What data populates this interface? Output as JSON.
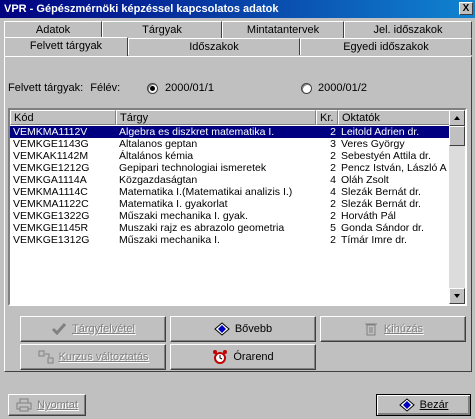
{
  "window": {
    "title": "VPR - Gépészmérnöki képzéssel kapcsolatos adatok",
    "close_glyph": "X"
  },
  "tabs": {
    "row1": [
      "Adatok",
      "Tárgyak",
      "Mintatantervek",
      "Jel. időszakok"
    ],
    "row2": [
      "Felvett tárgyak",
      "Időszakok",
      "Egyedi időszakok"
    ],
    "active": "Felvett tárgyak"
  },
  "semester": {
    "label": "Felvett tárgyak:",
    "period_label": "Félév:",
    "options": [
      {
        "label": "2000/01/1",
        "checked": true
      },
      {
        "label": "2000/01/2",
        "checked": false
      }
    ]
  },
  "table": {
    "columns": [
      "Kód",
      "Tárgy",
      "Kr.",
      "Oktatók"
    ],
    "selected_index": 0,
    "rows": [
      {
        "code": "VEMKMA1112V",
        "subject": "Algebra es diszkret matematika I.",
        "credits": "2",
        "teacher": "Leitold Adrien dr."
      },
      {
        "code": "VEMKGE1143G",
        "subject": "Altalanos geptan",
        "credits": "3",
        "teacher": "Veres György"
      },
      {
        "code": "VEMKAK1142M",
        "subject": "Általános kémia",
        "credits": "2",
        "teacher": "Sebestyén Attila dr."
      },
      {
        "code": "VEMKGE1212G",
        "subject": "Gepipari technologiai ismeretek",
        "credits": "2",
        "teacher": "Pencz István, László A"
      },
      {
        "code": "VEMKGA1114A",
        "subject": "Közgazdaságtan",
        "credits": "4",
        "teacher": "Oláh Zsolt"
      },
      {
        "code": "VEMKMA1114C",
        "subject": "Matematika I.(Matematikai analizis I.)",
        "credits": "4",
        "teacher": "Slezák Bernát dr."
      },
      {
        "code": "VEMKMA1122C",
        "subject": "Matematika I. gyakorlat",
        "credits": "2",
        "teacher": "Slezák Bernát dr."
      },
      {
        "code": "VEMKGE1322G",
        "subject": "Műszaki mechanika I. gyak.",
        "credits": "2",
        "teacher": "Horváth Pál"
      },
      {
        "code": "VEMKGE1145R",
        "subject": "Muszaki rajz es abrazolo geometria",
        "credits": "5",
        "teacher": "Gonda Sándor dr."
      },
      {
        "code": "VEMKGE1312G",
        "subject": "Műszaki mechanika I.",
        "credits": "2",
        "teacher": "Tímár Imre dr."
      }
    ]
  },
  "buttons": {
    "enroll": {
      "label": "Tárgyfelvétel",
      "icon": "check-icon",
      "enabled": false
    },
    "details": {
      "label": "Bővebb",
      "icon": "diamond-icon",
      "enabled": true
    },
    "drop": {
      "label": "Kihúzás",
      "icon": "trash-icon",
      "enabled": false
    },
    "change_course": {
      "label": "Kurzus változtatás",
      "icon": "swap-icon",
      "enabled": false
    },
    "timetable": {
      "label": "Órarend",
      "icon": "alarm-clock-icon",
      "enabled": true
    },
    "print": {
      "label": "Nyomtat",
      "icon": "printer-icon",
      "enabled": false
    },
    "close": {
      "label": "Bezár",
      "icon": "close-diamond-icon",
      "enabled": true
    }
  },
  "colors": {
    "titlebar": "#000080",
    "selection": "#000080",
    "face": "#c0c0c0",
    "alarm_red": "#c00000"
  }
}
